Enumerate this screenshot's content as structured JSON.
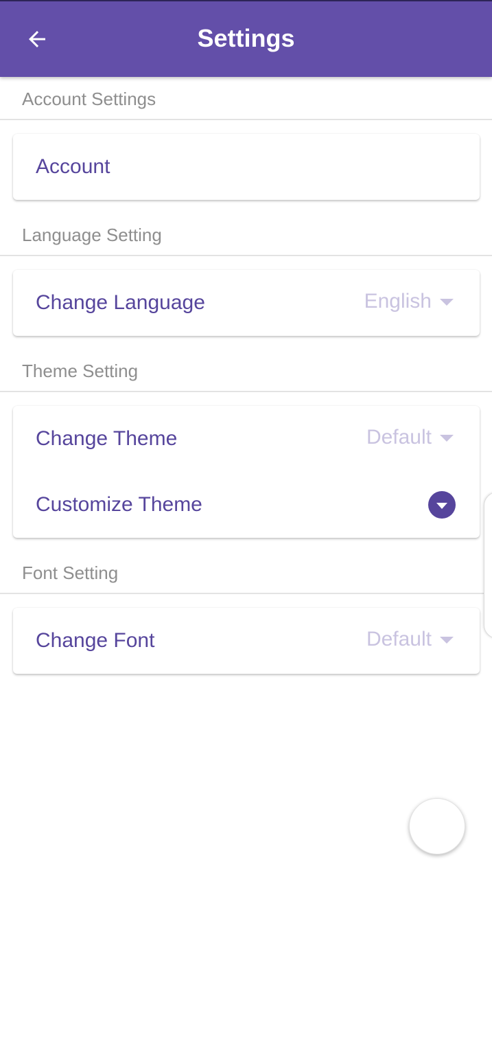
{
  "appbar": {
    "title": "Settings",
    "back_icon": "arrow-left-icon",
    "color": "#634fa9"
  },
  "sections": {
    "account": {
      "header": "Account Settings",
      "rows": {
        "account": {
          "label": "Account"
        }
      }
    },
    "language": {
      "header": "Language Setting",
      "rows": {
        "change_language": {
          "label": "Change Language",
          "value": "English"
        }
      }
    },
    "theme": {
      "header": "Theme Setting",
      "rows": {
        "change_theme": {
          "label": "Change Theme",
          "value": "Default"
        },
        "customize_theme": {
          "label": "Customize Theme",
          "icon": "expand-more-icon"
        }
      }
    },
    "font": {
      "header": "Font Setting",
      "rows": {
        "change_font": {
          "label": "Change Font",
          "value": "Default"
        }
      }
    }
  },
  "colors": {
    "accent": "#56459c",
    "dropdown_text": "#c9c3e0",
    "section_header": "#8e8e8e"
  }
}
